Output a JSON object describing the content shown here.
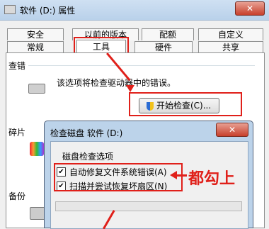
{
  "window": {
    "title": "软件 (D:) 属性",
    "close_label": "✕"
  },
  "tabs": {
    "row1": [
      "安全",
      "以前的版本",
      "配额",
      "自定义"
    ],
    "row2": [
      "常规",
      "工具",
      "硬件",
      "共享"
    ],
    "active": "工具"
  },
  "error_check": {
    "section_label": "查错",
    "description": "该选项将检查驱动器中的错误。",
    "button_label": "开始检查(C)..."
  },
  "defrag": {
    "section_label": "碎片"
  },
  "backup": {
    "section_label": "备份"
  },
  "dialog": {
    "title": "检查磁盘 软件 (D:)",
    "close_label": "✕",
    "group_label": "磁盘检查选项",
    "options": [
      {
        "label": "自动修复文件系统错误(A)",
        "checked": true
      },
      {
        "label": "扫描并尝试恢复坏扇区(N)",
        "checked": true
      }
    ]
  },
  "annotation": {
    "text": "都勾上",
    "color": "#e0201a"
  }
}
